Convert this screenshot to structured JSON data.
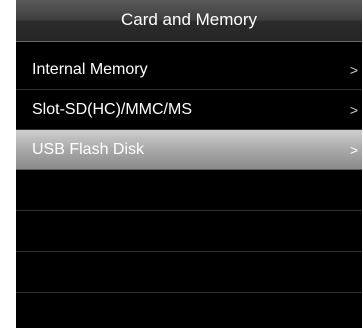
{
  "header": {
    "title": "Card and Memory"
  },
  "menu": {
    "items": [
      {
        "label": "Internal Memory",
        "chevron": ">",
        "selected": false
      },
      {
        "label": "Slot-SD(HC)/MMC/MS",
        "chevron": ">",
        "selected": false
      },
      {
        "label": "USB Flash Disk",
        "chevron": ">",
        "selected": true
      }
    ]
  },
  "icons": {
    "row_chevron": "chevron-right-icon"
  },
  "colors": {
    "background": "#000000",
    "text": "#ffffff",
    "selected_highlight": "#a9a9a9",
    "header": "#3f3f3f"
  }
}
